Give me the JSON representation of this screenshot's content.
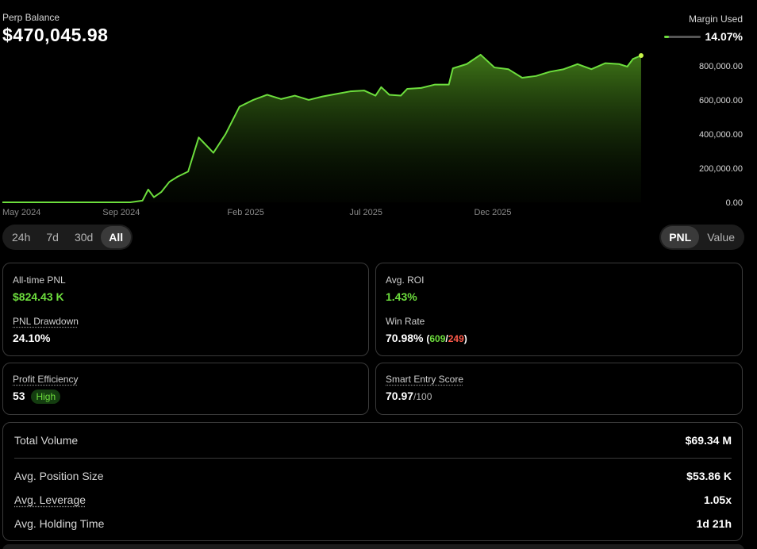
{
  "header": {
    "balance_label": "Perp Balance",
    "balance_value": "$470,045.98",
    "margin_label": "Margin Used",
    "margin_value": "14.07%",
    "margin_fraction": 0.1407
  },
  "chart_data": {
    "type": "area",
    "x_tick_labels": [
      "May 2024",
      "Sep 2024",
      "Feb 2025",
      "Jul 2025",
      "Dec 2025"
    ],
    "y_tick_labels": [
      "800,000.00",
      "600,000.00",
      "400,000.00",
      "200,000.00",
      "0.00"
    ],
    "y_ticks": [
      800000,
      600000,
      400000,
      200000,
      0
    ],
    "ylim": [
      0,
      860000
    ],
    "x_domain": [
      "2024-05-01",
      "2026-03-06"
    ],
    "grid": false,
    "legend": "none",
    "line_color": "#6dde3d",
    "points": [
      [
        "2024-05-01",
        0
      ],
      [
        "2024-06-15",
        0
      ],
      [
        "2024-07-30",
        0
      ],
      [
        "2024-09-15",
        0
      ],
      [
        "2024-10-05",
        0
      ],
      [
        "2024-10-20",
        10000
      ],
      [
        "2024-10-27",
        75000
      ],
      [
        "2024-11-03",
        30000
      ],
      [
        "2024-11-12",
        60000
      ],
      [
        "2024-11-22",
        120000
      ],
      [
        "2024-12-02",
        150000
      ],
      [
        "2024-12-15",
        180000
      ],
      [
        "2024-12-28",
        380000
      ],
      [
        "2025-01-15",
        290000
      ],
      [
        "2025-01-30",
        400000
      ],
      [
        "2025-02-16",
        560000
      ],
      [
        "2025-03-05",
        600000
      ],
      [
        "2025-03-22",
        630000
      ],
      [
        "2025-04-08",
        605000
      ],
      [
        "2025-04-25",
        625000
      ],
      [
        "2025-05-12",
        600000
      ],
      [
        "2025-05-29",
        620000
      ],
      [
        "2025-06-15",
        635000
      ],
      [
        "2025-07-02",
        650000
      ],
      [
        "2025-07-19",
        655000
      ],
      [
        "2025-08-02",
        625000
      ],
      [
        "2025-08-09",
        675000
      ],
      [
        "2025-08-19",
        630000
      ],
      [
        "2025-09-02",
        625000
      ],
      [
        "2025-09-10",
        665000
      ],
      [
        "2025-09-27",
        670000
      ],
      [
        "2025-10-14",
        690000
      ],
      [
        "2025-10-31",
        690000
      ],
      [
        "2025-11-05",
        785000
      ],
      [
        "2025-11-22",
        810000
      ],
      [
        "2025-12-09",
        865000
      ],
      [
        "2025-12-26",
        790000
      ],
      [
        "2026-01-12",
        780000
      ],
      [
        "2026-01-29",
        730000
      ],
      [
        "2026-02-15",
        740000
      ],
      [
        "2026-03-04",
        765000
      ],
      [
        "2026-03-21",
        780000
      ],
      [
        "2026-04-07",
        810000
      ],
      [
        "2026-04-24",
        780000
      ],
      [
        "2026-05-11",
        815000
      ],
      [
        "2026-05-28",
        810000
      ],
      [
        "2026-06-07",
        795000
      ],
      [
        "2026-06-14",
        840000
      ],
      [
        "2026-06-24",
        860000
      ]
    ]
  },
  "timeframes": [
    {
      "label": "24h",
      "active": false
    },
    {
      "label": "7d",
      "active": false
    },
    {
      "label": "30d",
      "active": false
    },
    {
      "label": "All",
      "active": true
    }
  ],
  "modes": [
    {
      "label": "PNL",
      "active": true
    },
    {
      "label": "Value",
      "active": false
    }
  ],
  "pnl_card": {
    "alltime_label": "All-time PNL",
    "alltime_value": "$824.43 K",
    "drawdown_label": "PNL Drawdown",
    "drawdown_value": "24.10%"
  },
  "roi_card": {
    "roi_label": "Avg. ROI",
    "roi_value": "1.43%",
    "winrate_label": "Win Rate",
    "winrate_value": "70.98%",
    "wins": "609",
    "losses": "249"
  },
  "efficiency_card": {
    "label": "Profit Efficiency",
    "value": "53",
    "badge": "High"
  },
  "entry_card": {
    "label": "Smart Entry Score",
    "value": "70.97",
    "suffix": "/100"
  },
  "volume_card": {
    "total_volume_label": "Total Volume",
    "total_volume_value": "$69.34 M",
    "position_size_label": "Avg. Position Size",
    "position_size_value": "$53.86 K",
    "leverage_label": "Avg. Leverage",
    "leverage_value": "1.05x",
    "holding_label": "Avg. Holding Time",
    "holding_value": "1d 21h"
  }
}
